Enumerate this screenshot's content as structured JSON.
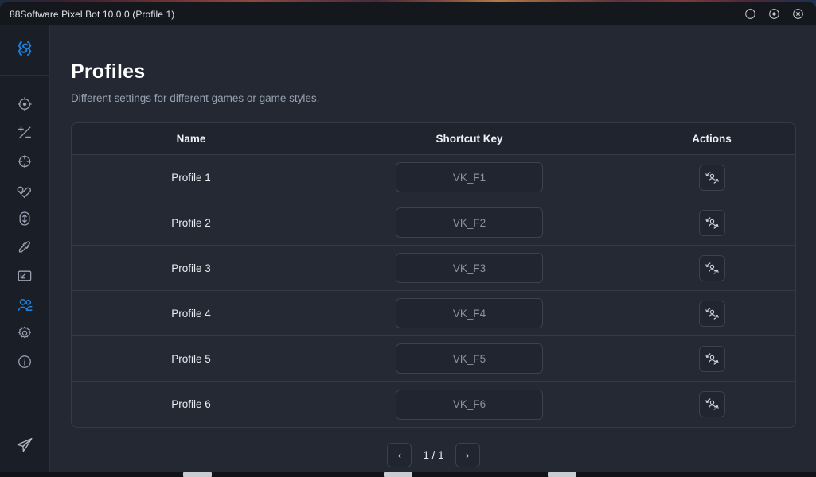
{
  "window": {
    "title": "88Software Pixel Bot 10.0.0 (Profile 1)",
    "controls": [
      {
        "name": "minimize-button",
        "icon": "circle-minus-icon"
      },
      {
        "name": "maximize-button",
        "icon": "circle-dot-icon"
      },
      {
        "name": "close-button",
        "icon": "circle-x-icon"
      }
    ]
  },
  "sidebar": {
    "logo": {
      "icon": "brace-s-logo-icon",
      "color": "#1d7fe0"
    },
    "items": [
      {
        "name": "sidebar-item-aim",
        "icon": "target-icon",
        "active": false
      },
      {
        "name": "sidebar-item-adjust",
        "icon": "plus-minus-icon",
        "active": false
      },
      {
        "name": "sidebar-item-crosshair",
        "icon": "crosshair-circle-icon",
        "active": false
      },
      {
        "name": "sidebar-item-magnet",
        "icon": "magnet-icon",
        "active": false
      },
      {
        "name": "sidebar-item-recoil",
        "icon": "arrow-up-down-circle-icon",
        "active": false
      },
      {
        "name": "sidebar-item-color-picker",
        "icon": "eyedropper-icon",
        "active": false
      },
      {
        "name": "sidebar-item-display",
        "icon": "screen-resize-icon",
        "active": false
      },
      {
        "name": "sidebar-item-profiles",
        "icon": "users-icon",
        "active": true
      },
      {
        "name": "sidebar-item-settings",
        "icon": "gear-icon",
        "active": false
      },
      {
        "name": "sidebar-item-info",
        "icon": "info-circle-icon",
        "active": false
      }
    ],
    "bottom": {
      "name": "sidebar-item-telegram",
      "icon": "paper-plane-icon"
    }
  },
  "page": {
    "title": "Profiles",
    "subtitle": "Different settings for different games or game styles."
  },
  "table": {
    "headers": [
      "Name",
      "Shortcut Key",
      "Actions"
    ],
    "rows": [
      {
        "name": "Profile 1",
        "key": "VK_F1",
        "action_icon": "switch-user-icon"
      },
      {
        "name": "Profile 2",
        "key": "VK_F2",
        "action_icon": "switch-user-icon"
      },
      {
        "name": "Profile 3",
        "key": "VK_F3",
        "action_icon": "switch-user-icon"
      },
      {
        "name": "Profile 4",
        "key": "VK_F4",
        "action_icon": "switch-user-icon"
      },
      {
        "name": "Profile 5",
        "key": "VK_F5",
        "action_icon": "switch-user-icon"
      },
      {
        "name": "Profile 6",
        "key": "VK_F6",
        "action_icon": "switch-user-icon"
      }
    ]
  },
  "pagination": {
    "prev_label": "‹",
    "next_label": "›",
    "page_label": "1 / 1"
  },
  "colors": {
    "accent": "#1d7fe0",
    "window_bg": "#232833",
    "sidebar_bg": "#1a1f27",
    "titlebar_bg": "#14171c",
    "border": "#343b48",
    "text_primary": "#e8ebf0",
    "text_muted": "#8b93a3"
  }
}
